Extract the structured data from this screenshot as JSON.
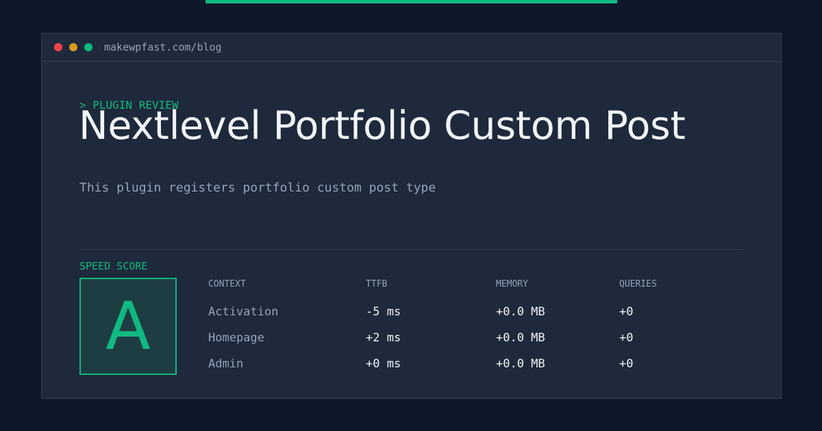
{
  "browser": {
    "url": "makewpfast.com/blog"
  },
  "hero": {
    "eyebrow": "> PLUGIN REVIEW",
    "title": "Nextlevel Portfolio Custom Post",
    "subtitle": "This plugin registers portfolio custom post type"
  },
  "score": {
    "label": "SPEED SCORE",
    "grade": "A"
  },
  "table": {
    "headers": [
      "CONTEXT",
      "TTFB",
      "MEMORY",
      "QUERIES"
    ],
    "rows": [
      [
        "Activation",
        "-5 ms",
        "+0.0 MB",
        "+0"
      ],
      [
        "Homepage",
        "+2 ms",
        "+0.0 MB",
        "+0"
      ],
      [
        "Admin",
        "+0 ms",
        "+0.0 MB",
        "+0"
      ]
    ]
  },
  "colors": {
    "background": "#0f172a",
    "panel": "#1e293b",
    "accent": "#10b981",
    "text": "#f1f5f9",
    "muted": "#94a3b8",
    "dot_red": "#ef4444",
    "dot_yellow": "#d89b1d",
    "dot_green": "#10b981"
  }
}
